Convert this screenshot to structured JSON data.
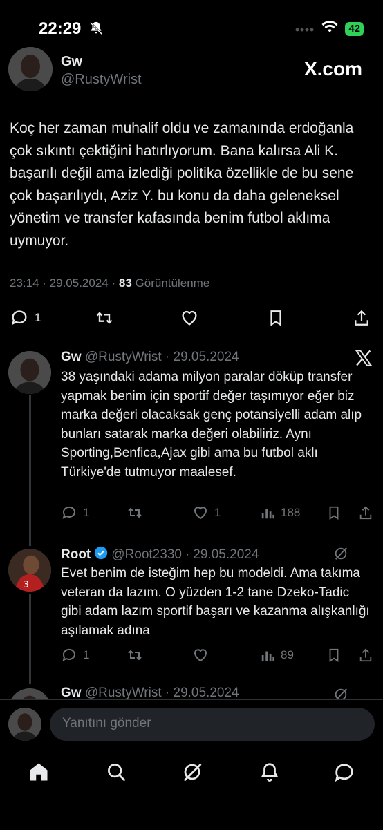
{
  "status_bar": {
    "time": "22:29",
    "battery": "42"
  },
  "main_tweet": {
    "name": "Gw",
    "handle": "@RustyWrist",
    "source_logo": "X.com",
    "text": "Koç her zaman muhalif oldu ve zamanında erdoğanla çok sıkıntı çektiğini hatırlıyorum. Bana kalırsa Ali K. başarılı değil ama izlediği politika özellikle de bu sene çok başarılıydı, Aziz Y. bu konu da daha geleneksel yönetim ve transfer kafasında benim futbol aklıma uymuyor.",
    "time": "23:14",
    "date": "29.05.2024",
    "views_count": "83",
    "views_label": "Görüntülenme",
    "replies": "1"
  },
  "replies": [
    {
      "name": "Gw",
      "handle": "@RustyWrist",
      "date": "29.05.2024",
      "text": "38 yaşındaki adama milyon paralar döküp transfer yapmak benim için sportif değer taşımıyor eğer biz marka değeri olacaksak genç potansiyelli adam alıp bunları satarak marka değeri olabiliriz. Aynı Sporting,Benfica,Ajax gibi ama bu futbol aklı Türkiye'de tutmuyor maalesef.",
      "replies": "1",
      "likes": "1",
      "views": "188"
    },
    {
      "name": "Root",
      "handle": "@Root2330",
      "date": "29.05.2024",
      "text": "Evet benim de isteğim hep bu modeldi. Ama takıma veteran da lazım. O yüzden 1-2 tane Dzeko-Tadic gibi adam lazım sportif başarı ve kazanma alışkanlığı aşılamak adına",
      "replies": "1",
      "views": "89"
    },
    {
      "name": "Gw",
      "handle": "@RustyWrist",
      "date": "29.05.2024"
    }
  ],
  "composer": {
    "placeholder": "Yanıtını gönder"
  },
  "colors": {
    "background": "#000000",
    "text": "#e7e9ea",
    "muted": "#71767b",
    "verified": "#1d9bf0"
  }
}
